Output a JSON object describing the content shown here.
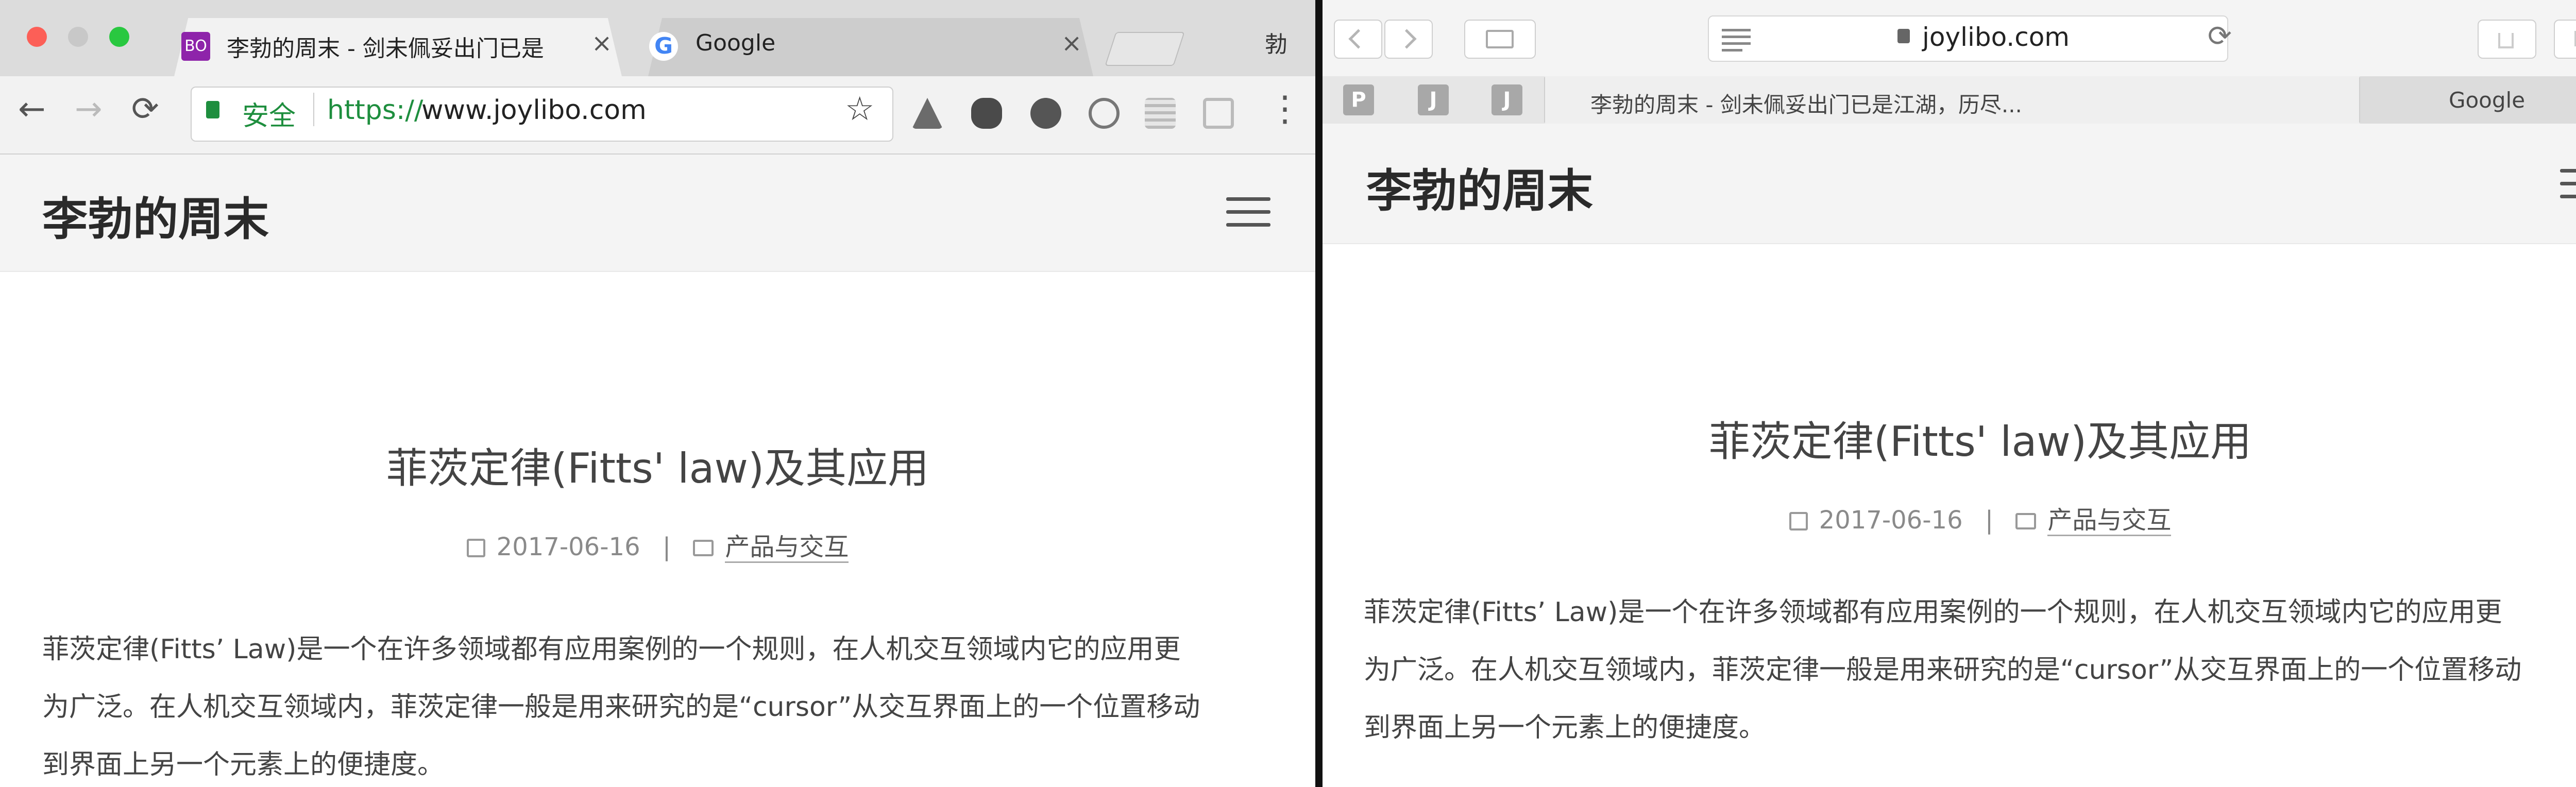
{
  "chrome": {
    "tabs": [
      {
        "favicon_text": "BO",
        "title": "李勃的周末 - 剑未佩妥出门已是",
        "active": true
      },
      {
        "favicon_text": "G",
        "title": "Google",
        "active": false
      }
    ],
    "profile_name": "勃",
    "close_glyph": "×",
    "nav": {
      "back": "←",
      "forward": "→",
      "reload": "⟳",
      "menu": "⋮",
      "star": "☆"
    },
    "omnibox": {
      "secure_label": "安全",
      "scheme": "https://",
      "host": "www.joylibo.com"
    }
  },
  "safari": {
    "address": "joylibo.com",
    "pinned_tabs": [
      "P",
      "J",
      "J"
    ],
    "tabs": [
      {
        "title": "李勃的周末 - 剑未佩妥出门已是江湖，历尽...",
        "active": true
      },
      {
        "title": "Google",
        "active": false
      }
    ],
    "new_tab": "+"
  },
  "page": {
    "site_title": "李勃的周末",
    "article_title": "菲茨定律(Fitts' law)及其应用",
    "date": "2017-06-16",
    "separator": "|",
    "category": "产品与交互",
    "paragraph_lines_chrome": [
      "菲茨定律(Fitts’ Law)是一个在许多领域都有应用案例的一个规则，在人机交互领域内它的应用更",
      "为广泛。在人机交互领域内，菲茨定律一般是用来研究的是“cursor”从交互界面上的一个位置移动",
      "到界面上另一个元素上的便捷度。"
    ],
    "paragraph_lines_safari": [
      "菲茨定律(Fitts’ Law)是一个在许多领域都有应用案例的一个规则，在人机交互领域内它的应用更",
      "为广泛。在人机交互领域内，菲茨定律一般是用来研究的是“cursor”从交互界面上的一个位置移动",
      "到界面上另一个元素上的便捷度。"
    ]
  },
  "colors": {
    "close": "#fc5f57",
    "minimize": "#fdbc2e",
    "zoom": "#29c840",
    "secure_green": "#1e8e3e",
    "favicon_purple": "#8e24aa"
  }
}
